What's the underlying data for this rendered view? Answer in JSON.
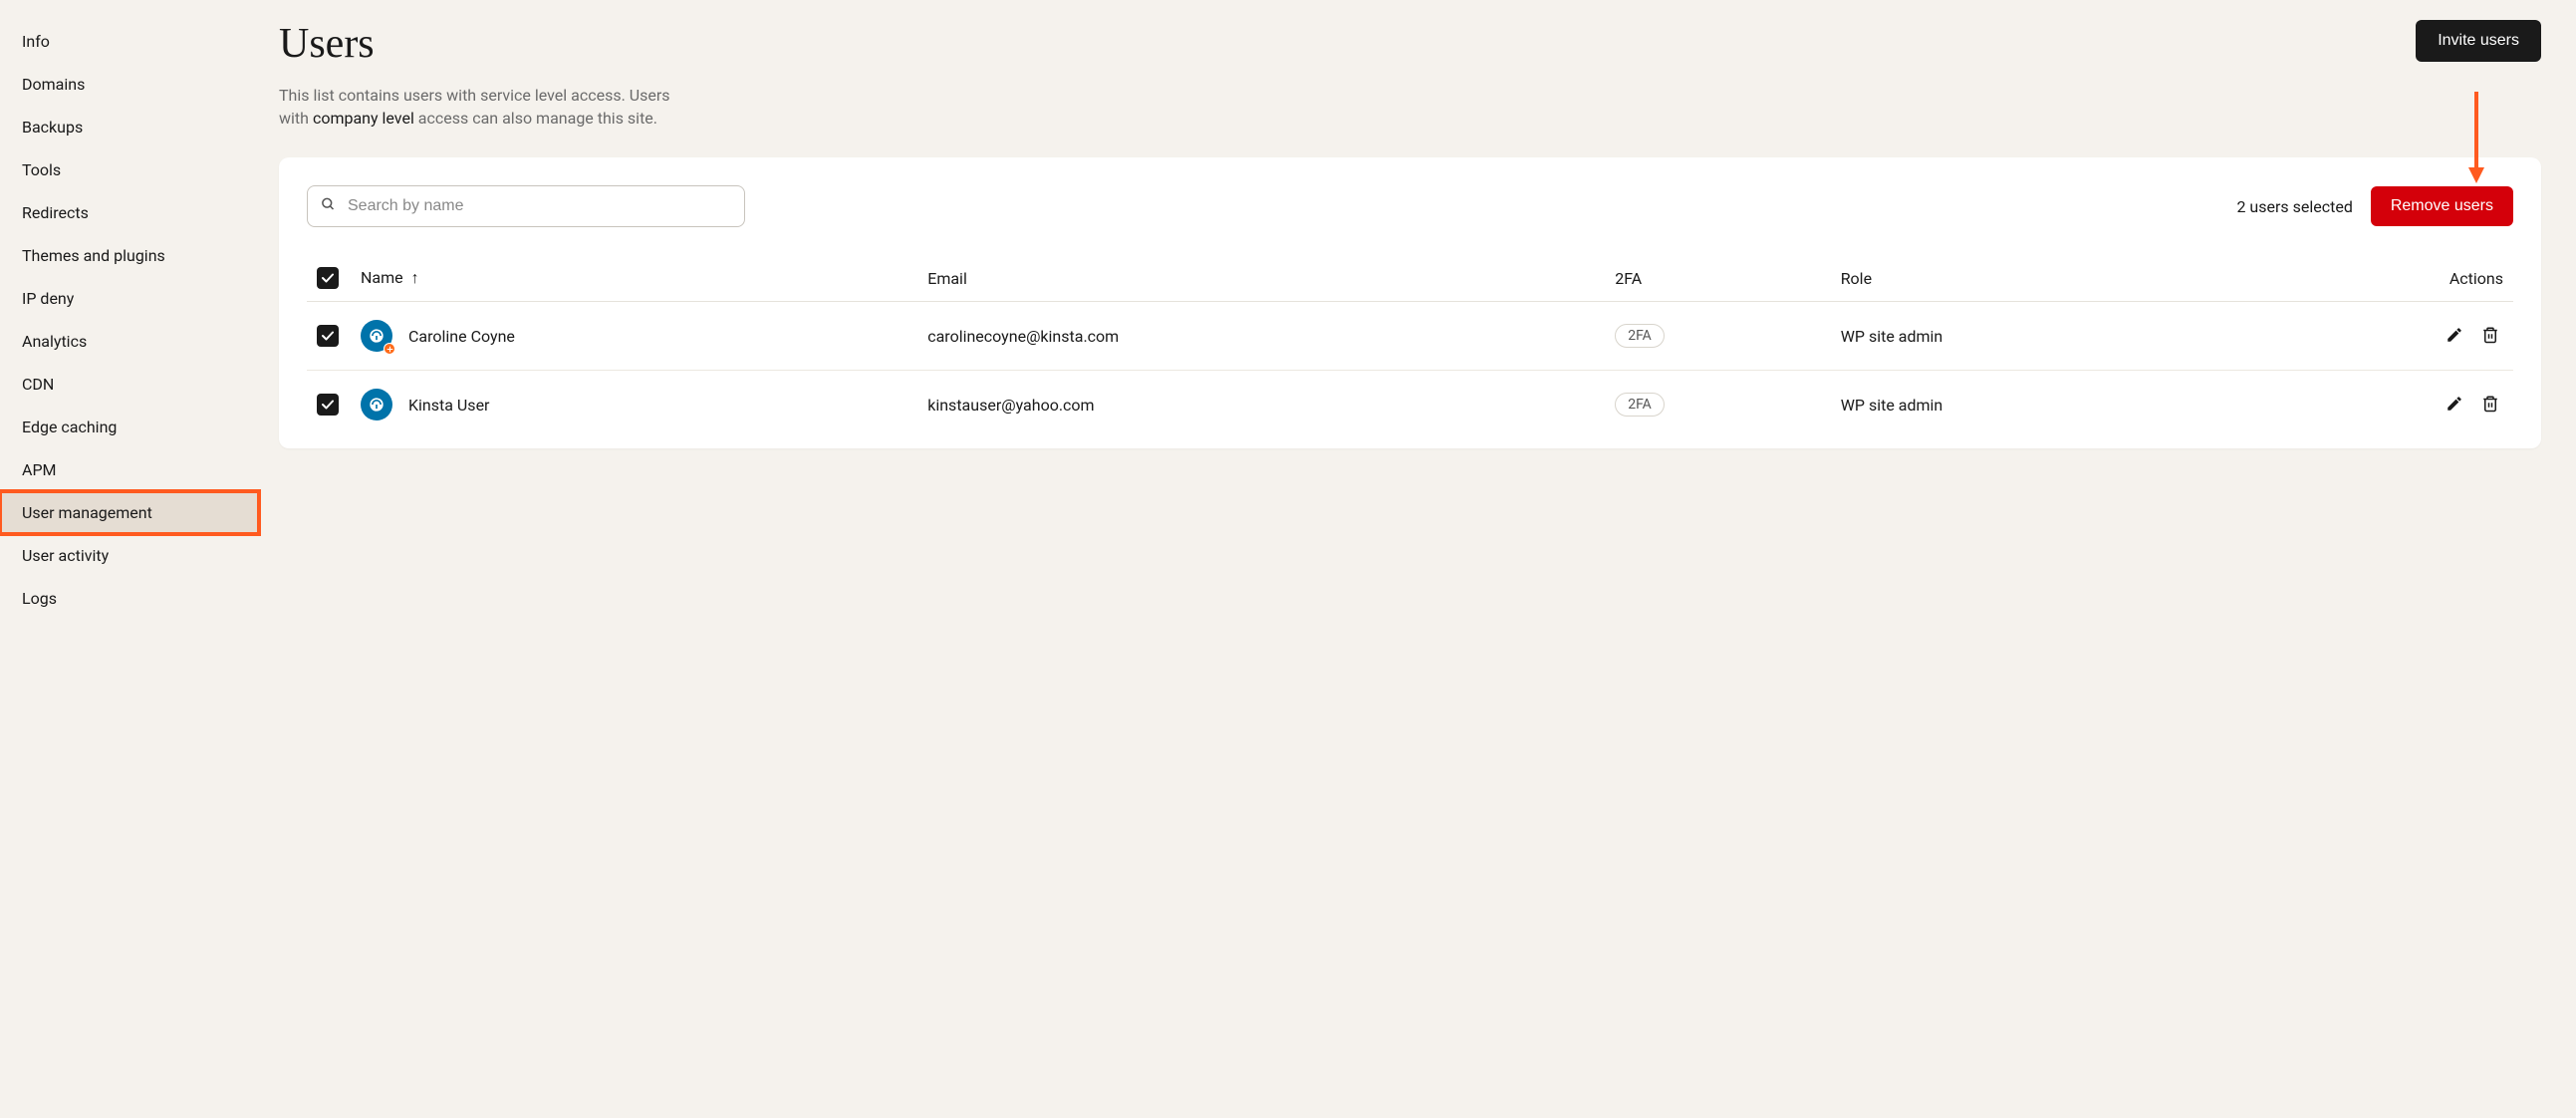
{
  "sidebar": {
    "items": [
      {
        "label": "Info",
        "active": false
      },
      {
        "label": "Domains",
        "active": false
      },
      {
        "label": "Backups",
        "active": false
      },
      {
        "label": "Tools",
        "active": false
      },
      {
        "label": "Redirects",
        "active": false
      },
      {
        "label": "Themes and plugins",
        "active": false
      },
      {
        "label": "IP deny",
        "active": false
      },
      {
        "label": "Analytics",
        "active": false
      },
      {
        "label": "CDN",
        "active": false
      },
      {
        "label": "Edge caching",
        "active": false
      },
      {
        "label": "APM",
        "active": false
      },
      {
        "label": "User management",
        "active": true
      },
      {
        "label": "User activity",
        "active": false
      },
      {
        "label": "Logs",
        "active": false
      }
    ]
  },
  "header": {
    "title": "Users",
    "description_pre": "This list contains users with service level access. Users with ",
    "description_strong": "company level",
    "description_post": " access can also manage this site.",
    "invite_button": "Invite users"
  },
  "toolbar": {
    "search_placeholder": "Search by name",
    "selected_text": "2 users selected",
    "remove_button": "Remove users"
  },
  "table": {
    "columns": {
      "name": "Name",
      "email": "Email",
      "twofa": "2FA",
      "role": "Role",
      "actions": "Actions"
    },
    "sort": {
      "column": "name",
      "direction": "asc"
    },
    "rows": [
      {
        "checked": true,
        "name": "Caroline Coyne",
        "email": "carolinecoyne@kinsta.com",
        "twofa_badge": "2FA",
        "role": "WP site admin",
        "avatar_badge": true
      },
      {
        "checked": true,
        "name": "Kinsta User",
        "email": "kinstauser@yahoo.com",
        "twofa_badge": "2FA",
        "role": "WP site admin",
        "avatar_badge": false
      }
    ]
  },
  "annotation": {
    "arrow_color": "#ff5a1f",
    "highlight_color": "#ff5a1f"
  }
}
